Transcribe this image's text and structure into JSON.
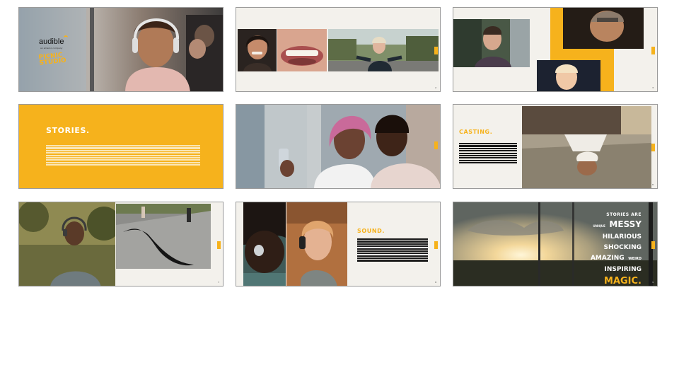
{
  "deck": {
    "theme": {
      "accent": "#f6b21c",
      "background": "#f3f1ec",
      "dark": "#1a1a1a",
      "border": "#9a9a9a"
    },
    "slides": [
      {
        "id": "cover",
        "logos": {
          "primary": "audible",
          "primary_sub": "an amazon company",
          "secondary": "PICNIC STUDIO"
        },
        "page": ""
      },
      {
        "id": "faces",
        "page": "2"
      },
      {
        "id": "laughing",
        "page": "3"
      },
      {
        "id": "stories",
        "heading": "STORIES.",
        "page": ""
      },
      {
        "id": "phone",
        "page": ""
      },
      {
        "id": "casting",
        "heading": "CASTING.",
        "page": "6"
      },
      {
        "id": "running",
        "page": "7"
      },
      {
        "id": "sound",
        "heading": "SOUND.",
        "page": "8"
      },
      {
        "id": "magic",
        "lines": [
          {
            "words": [
              {
                "t": "STORIES ARE",
                "size": "s"
              }
            ]
          },
          {
            "words": [
              {
                "t": "UNIQUE",
                "size": "xs"
              },
              {
                "t": "MESSY",
                "size": "l"
              }
            ]
          },
          {
            "words": [
              {
                "t": "HILARIOUS",
                "size": "m"
              }
            ]
          },
          {
            "words": [
              {
                "t": "SHOCKING",
                "size": "m"
              }
            ]
          },
          {
            "words": [
              {
                "t": "AMAZING",
                "size": "m"
              },
              {
                "t": "WEIRD",
                "size": "xs"
              }
            ]
          },
          {
            "words": [
              {
                "t": "INSPIRING",
                "size": "m"
              }
            ]
          }
        ],
        "final": "MAGIC.",
        "page": "9"
      }
    ]
  }
}
